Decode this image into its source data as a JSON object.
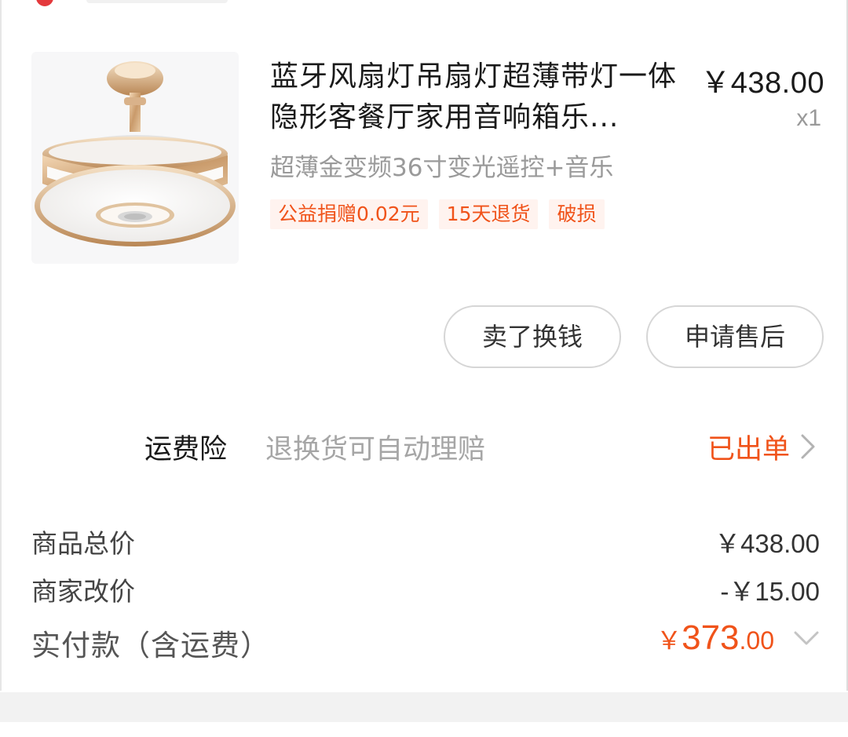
{
  "product": {
    "title": "蓝牙风扇灯吊扇灯超薄带灯一体隐形客餐厅家用音响箱乐...",
    "price": "￥438.00",
    "quantity": "x1",
    "sku": "超薄金变频36寸变光遥控+音乐",
    "tags": [
      "公益捐赠0.02元",
      "15天退货",
      "破损"
    ],
    "image": "ceiling-fan-light-icon"
  },
  "actions": {
    "sell_label": "卖了换钱",
    "aftersale_label": "申请售后"
  },
  "insurance": {
    "label": "运费险",
    "description": "退换货可自动理赔",
    "status": "已出单"
  },
  "summary": {
    "goods_total_label": "商品总价",
    "goods_total_value": "￥438.00",
    "seller_adjust_label": "商家改价",
    "seller_adjust_value": "-￥15.00",
    "paid_label": "实付款（含运费）",
    "paid_symbol": "￥",
    "paid_integer": "373",
    "paid_decimal": ".00"
  },
  "colors": {
    "accent": "#f0531a",
    "tag_bg": "#fff3ef",
    "brand_red": "#e4393c"
  },
  "icons": {
    "insurance_chevron": "chevron-right-icon",
    "paid_chevron": "chevron-down-icon"
  }
}
